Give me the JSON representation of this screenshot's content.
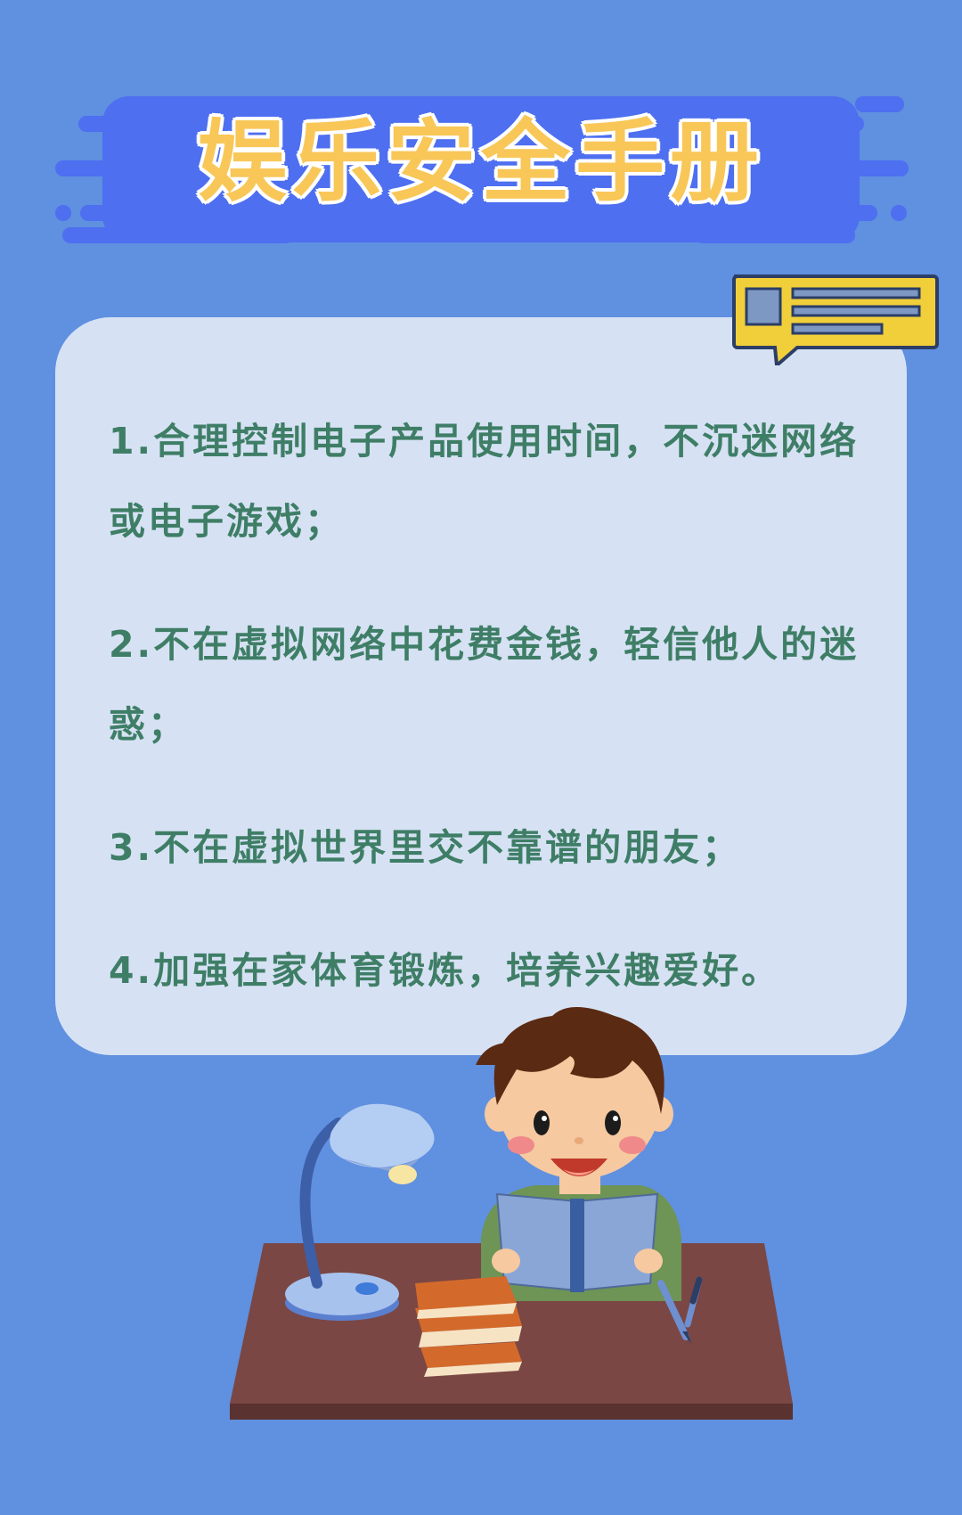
{
  "title": "娱乐安全手册",
  "tips": [
    "1.合理控制电子产品使用时间，不沉迷网络或电子游戏；",
    "2.不在虚拟网络中花费金钱，轻信他人的迷惑；",
    "3.不在虚拟世界里交不靠谱的朋友；",
    "4.加强在家体育锻炼，培养兴趣爱好。"
  ],
  "colors": {
    "background": "#6090e0",
    "banner": "#4d6ff0",
    "title": "#f8c758",
    "card": "#d6e2f4",
    "tip_text": "#3f7e66"
  },
  "icons": [
    "chat-bubble-icon",
    "desk-lamp-icon",
    "book-stack-icon",
    "pencil-icon",
    "pen-icon"
  ]
}
